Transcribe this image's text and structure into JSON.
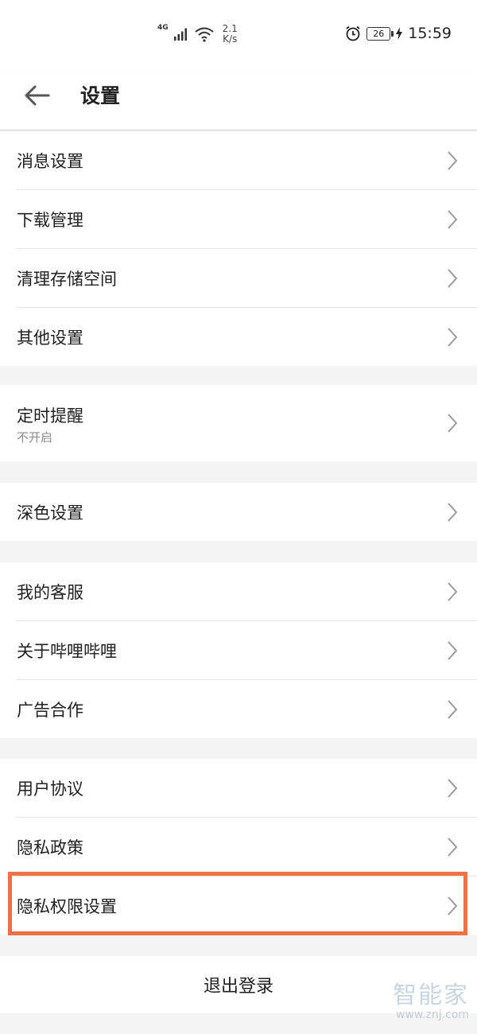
{
  "status_bar": {
    "network": "4G",
    "speed_value": "2.1",
    "speed_unit": "K/s",
    "battery": "26",
    "time": "15:59",
    "icons": [
      "signal-icon",
      "wifi-icon",
      "alarm-icon",
      "battery-icon",
      "charging-icon"
    ]
  },
  "header": {
    "back_icon": "back-arrow-icon",
    "title": "设置"
  },
  "sections": [
    {
      "items": [
        {
          "label": "消息设置"
        },
        {
          "label": "下载管理"
        },
        {
          "label": "清理存储空间"
        },
        {
          "label": "其他设置"
        }
      ]
    },
    {
      "items": [
        {
          "label": "定时提醒",
          "sub": "不开启"
        }
      ]
    },
    {
      "items": [
        {
          "label": "深色设置"
        }
      ]
    },
    {
      "items": [
        {
          "label": "我的客服"
        },
        {
          "label": "关于哔哩哔哩"
        },
        {
          "label": "广告合作"
        }
      ]
    },
    {
      "items": [
        {
          "label": "用户协议"
        },
        {
          "label": "隐私政策"
        },
        {
          "label": "隐私权限设置"
        }
      ]
    }
  ],
  "logout_label": "退出登录",
  "watermark": {
    "name": "智能家",
    "url": "www.znj.com"
  },
  "colors": {
    "highlight": "#f07145",
    "background": "#f4f4f4",
    "text": "#212121",
    "subtext": "#8c8c8c"
  }
}
